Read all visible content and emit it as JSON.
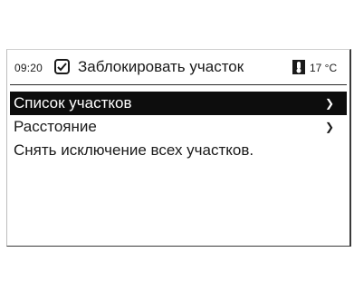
{
  "status": {
    "time": "09:20",
    "title": "Заблокировать участок",
    "temperature": "17 °C",
    "icons": [
      "checkbox-icon",
      "thermometer-icon"
    ]
  },
  "menu": {
    "items": [
      {
        "label": "Список участков",
        "has_submenu": true,
        "selected": true
      },
      {
        "label": "Расстояние",
        "has_submenu": true,
        "selected": false
      },
      {
        "label": "Снять исключение всех участков.",
        "has_submenu": false,
        "selected": false
      }
    ],
    "arrow_glyph": "❯"
  },
  "colors": {
    "selected_background": "#0d0d0d",
    "selected_text": "#ffffff",
    "text": "#1a1a1a",
    "background": "#ffffff"
  }
}
